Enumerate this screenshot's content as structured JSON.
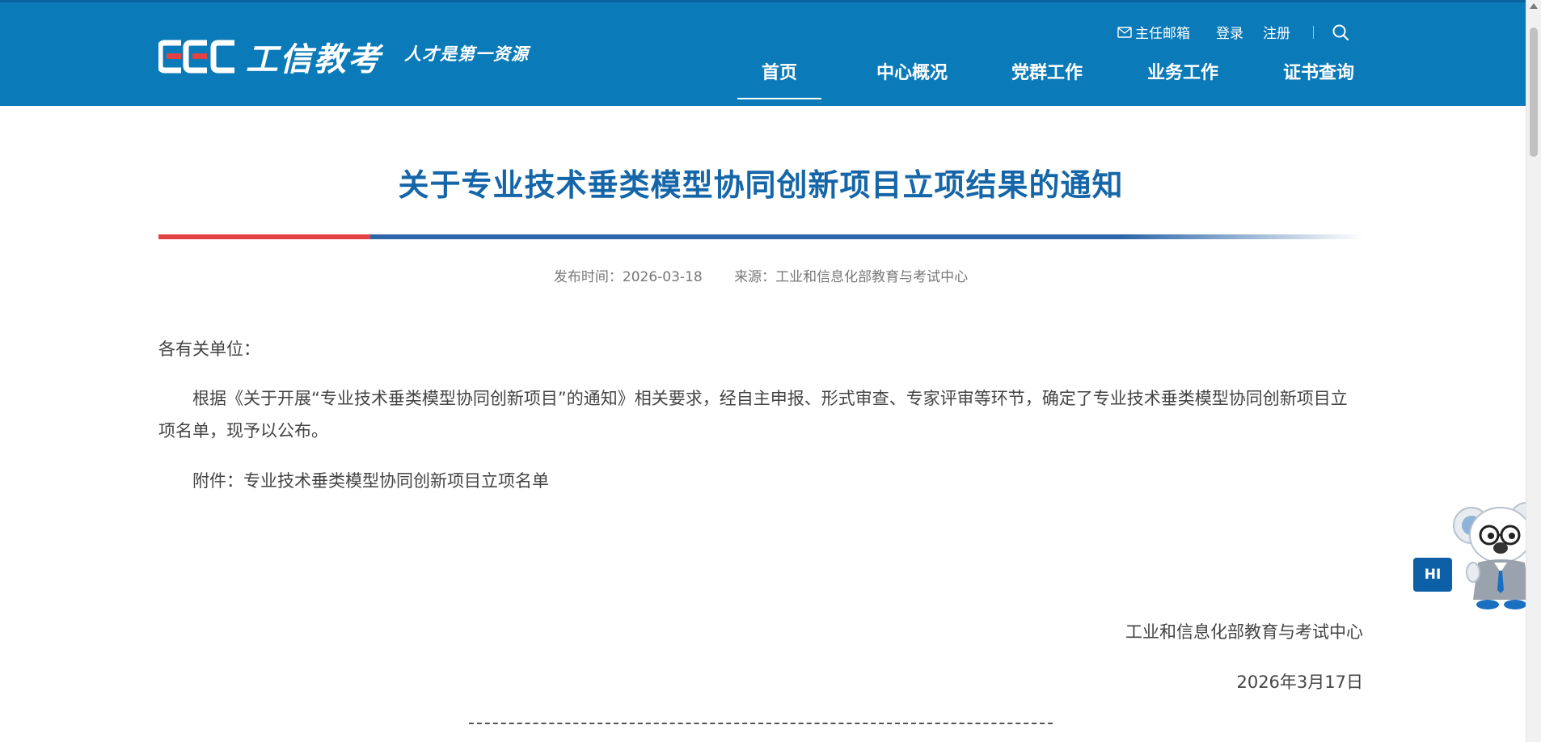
{
  "header": {
    "logo_text": "工信教考",
    "slogan": "人才是第一资源",
    "top_links": {
      "mailbox": "主任邮箱",
      "login": "登录",
      "register": "注册"
    },
    "nav": [
      {
        "label": "首页",
        "active": true
      },
      {
        "label": "中心概况",
        "active": false
      },
      {
        "label": "党群工作",
        "active": false
      },
      {
        "label": "业务工作",
        "active": false
      },
      {
        "label": "证书查询",
        "active": false
      }
    ]
  },
  "article": {
    "title": "关于专业技术垂类模型协同创新项目立项结果的通知",
    "publish_label": "发布时间：",
    "publish_date": "2026-03-18",
    "source_label": "来源：",
    "source": "工业和信息化部教育与考试中心",
    "salutation": "各有关单位：",
    "paragraph1": "根据《关于开展“专业技术垂类模型协同创新项目”的通知》相关要求，经自主申报、形式审查、专家评审等环节，确定了专业技术垂类模型协同创新项目立项名单，现予以公布。",
    "attachment": "附件：专业技术垂类模型协同创新项目立项名单",
    "signature_org": "工业和信息化部教育与考试中心",
    "signature_date": "2026年3月17日"
  },
  "assistant": {
    "greeting": "HI"
  },
  "colors": {
    "header_bg": "#0a7ab8",
    "title": "#1566a8",
    "accent_red": "#e24244",
    "accent_blue": "#2d66a8"
  }
}
